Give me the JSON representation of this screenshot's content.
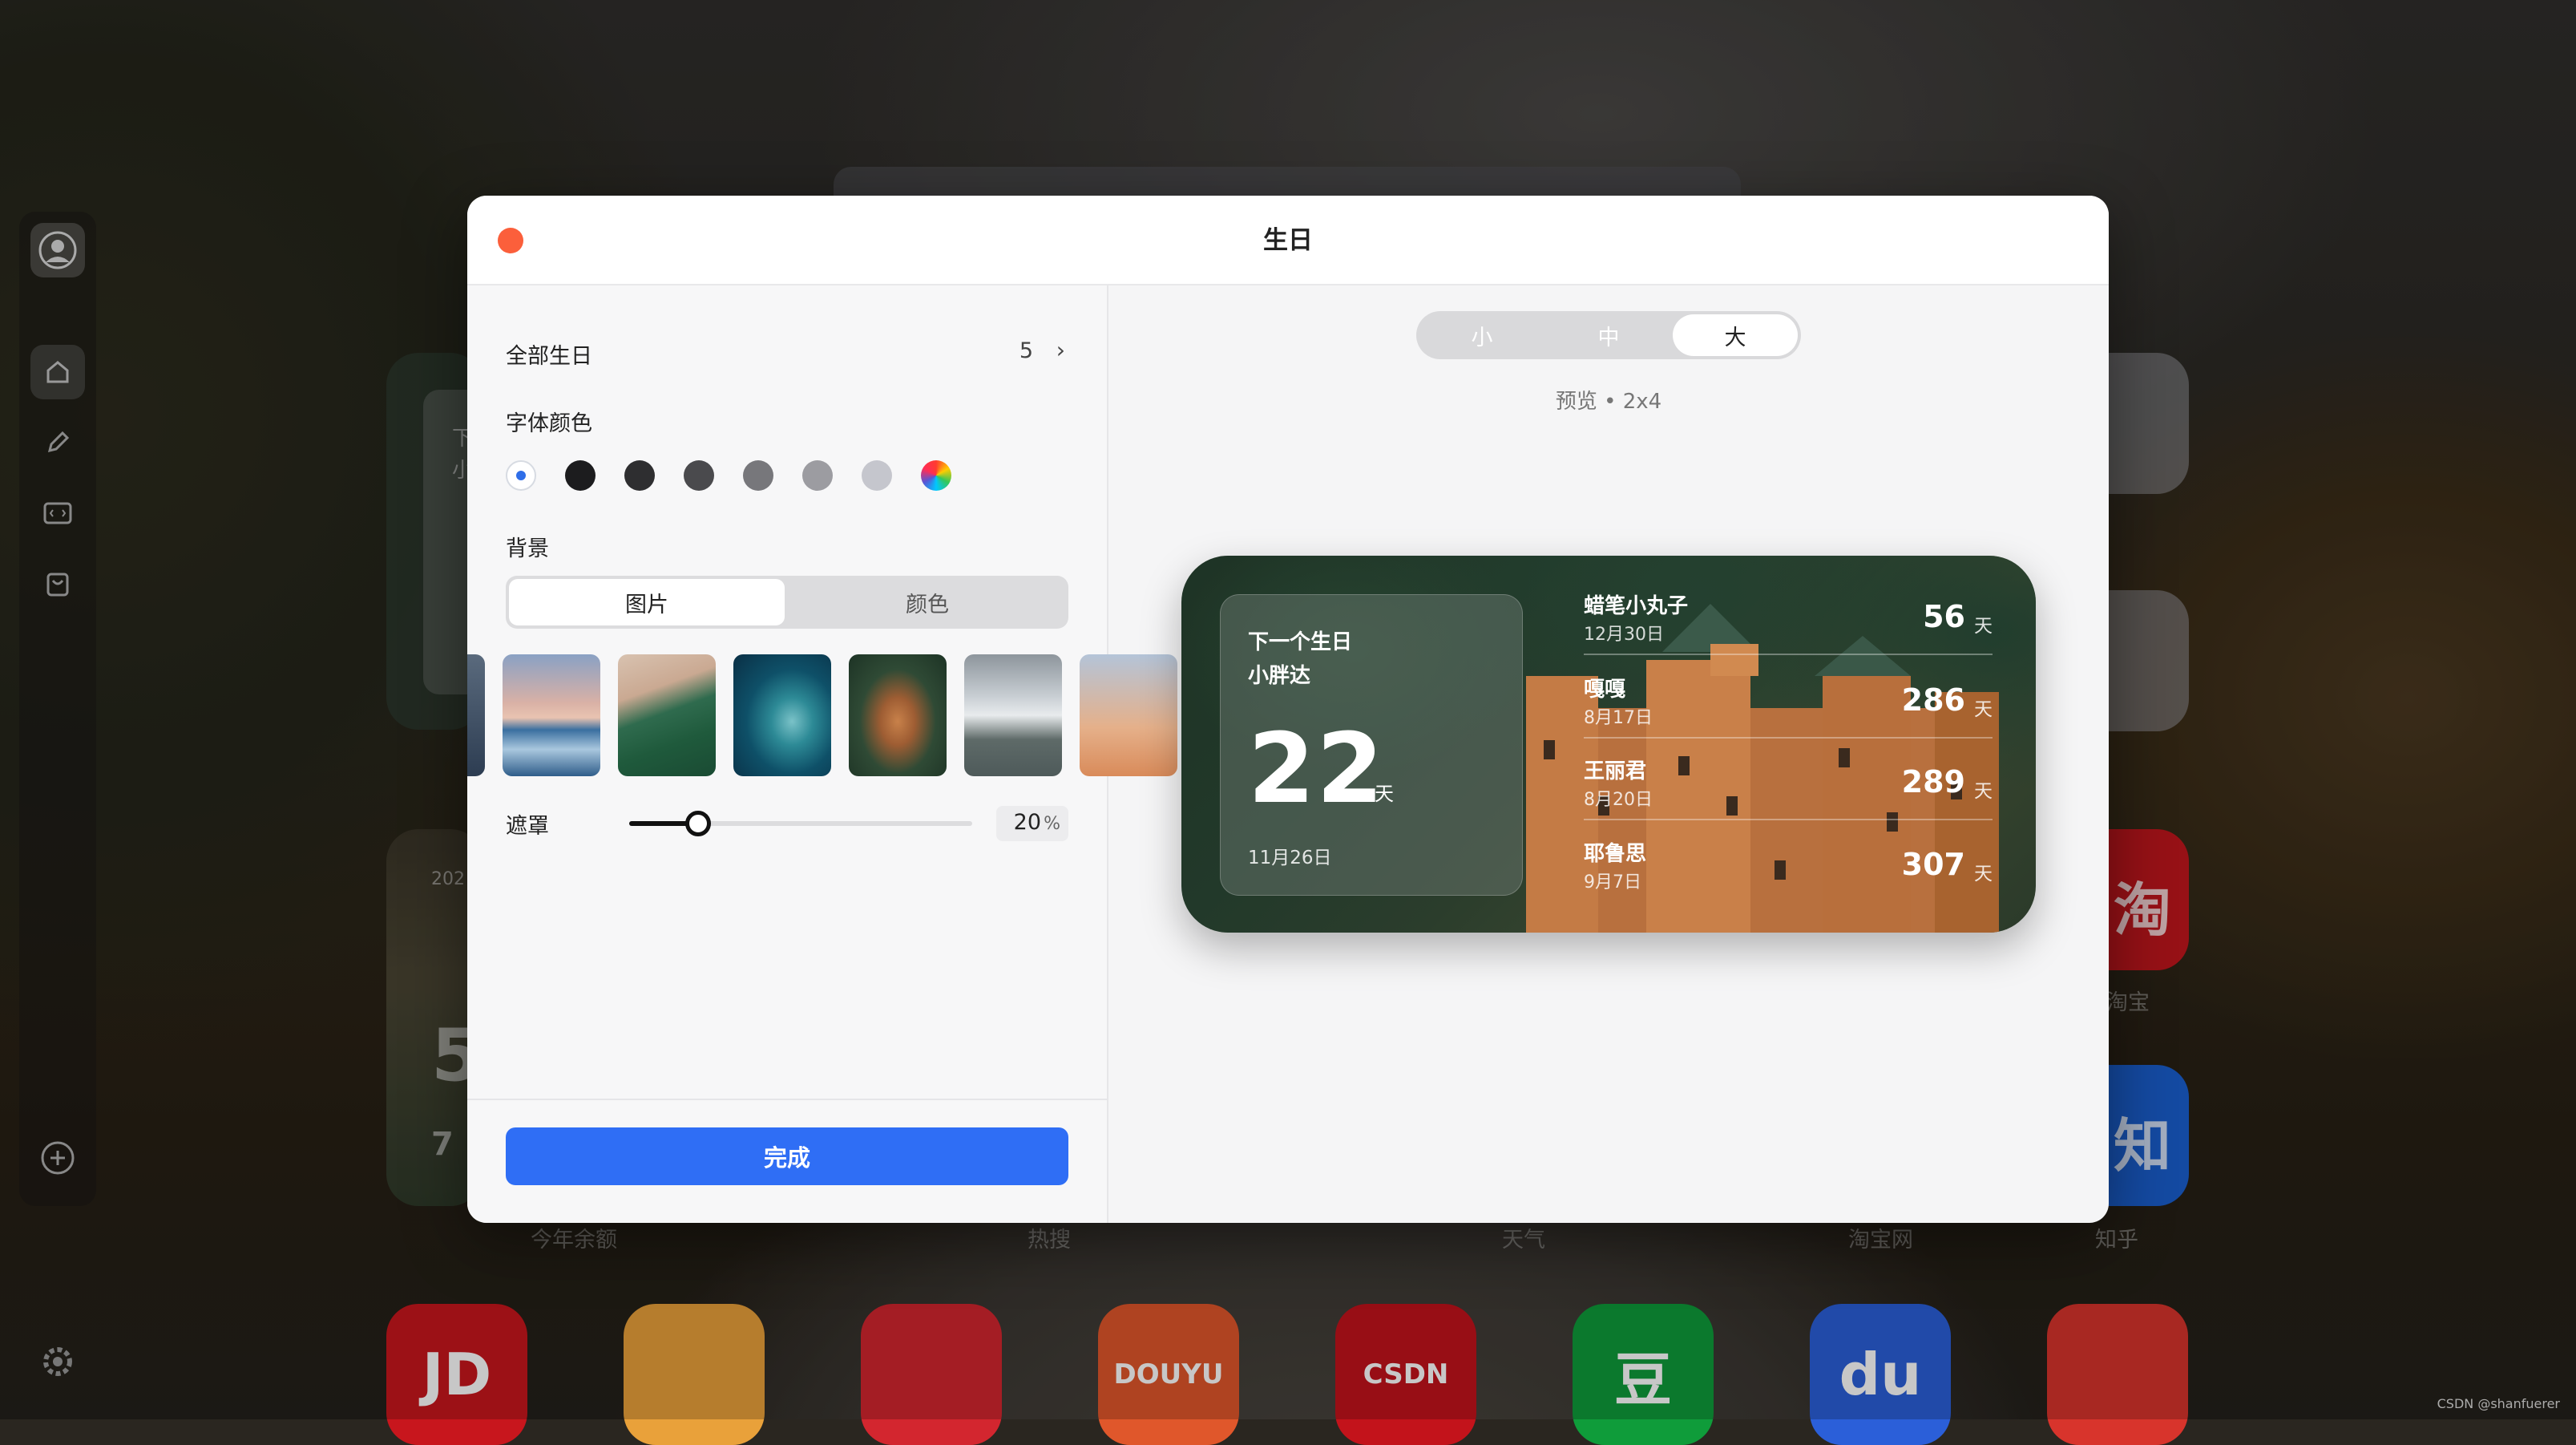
{
  "modal": {
    "title": "生日",
    "all_birthdays_label": "全部生日",
    "all_birthdays_count": "5",
    "chevron": "›",
    "font_color_label": "字体颜色",
    "font_colors": [
      "#ffffff",
      "#1c1c1e",
      "#2e2e30",
      "#4a4a4d",
      "#77777b",
      "#9c9ca1",
      "#c5c6cd",
      "rainbow"
    ],
    "background_label": "背景",
    "bg_tabs": {
      "image": "图片",
      "color": "颜色"
    },
    "mask_label": "遮罩",
    "mask_value": "20",
    "mask_unit": "%",
    "mask_fraction": 0.2,
    "done_label": "完成"
  },
  "size_options": [
    "小",
    "中",
    "大"
  ],
  "size_selected": "大",
  "preview_label": "预览 • 2x4",
  "widget": {
    "next_title": "下一个生日",
    "next_name": "小胖达",
    "next_days": "22",
    "day_unit": "天",
    "next_date": "11月26日",
    "list": [
      {
        "name": "蜡笔小丸子",
        "date": "12月30日",
        "days": "56"
      },
      {
        "name": "嘎嘎",
        "date": "8月17日",
        "days": "286"
      },
      {
        "name": "王丽君",
        "date": "8月20日",
        "days": "289"
      },
      {
        "name": "耶鲁思",
        "date": "9月7日",
        "days": "307"
      }
    ]
  },
  "background_app": {
    "labels": [
      "今年余额",
      "热搜",
      "天气",
      "淘宝网",
      "知乎"
    ],
    "tiles": [
      {
        "text": "JD",
        "color": "#c8161d"
      },
      {
        "text": "",
        "color": "#e9a13a"
      },
      {
        "text": "",
        "color": "#d3262f"
      },
      {
        "text": "DOUYU",
        "color": "#e0572b"
      },
      {
        "text": "CSDN",
        "color": "#c3131b"
      },
      {
        "text": "豆",
        "color": "#0f9c3a"
      },
      {
        "text": "du",
        "color": "#2b5fd9"
      },
      {
        "text": "",
        "color": "#d8342c"
      }
    ],
    "taobao_glyph": "淘",
    "zhihu_glyph": "知",
    "partial_text_1": "下",
    "partial_text_2": "小",
    "partial_year": "202",
    "partial_big": "5",
    "partial_small": "7",
    "taobao_label": "淘宝"
  },
  "credit": "CSDN @shanfuerer"
}
